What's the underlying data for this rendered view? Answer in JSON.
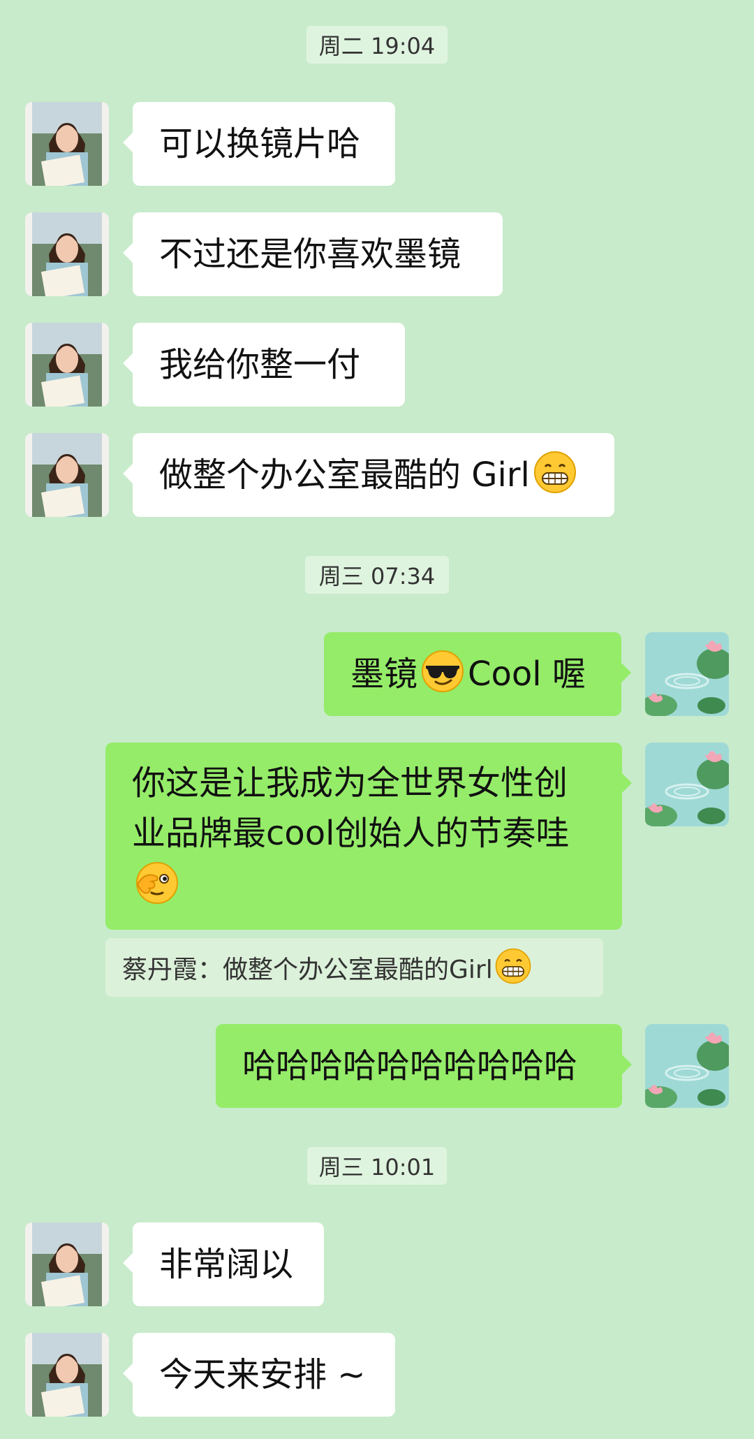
{
  "timestamps": [
    "周二 19:04",
    "周三 07:34",
    "周三 10:01"
  ],
  "messages": [
    {
      "text": "可以换镜片哈"
    },
    {
      "text": "不过还是你喜欢墨镜"
    },
    {
      "text": "我给你整一付"
    },
    {
      "text": "做整个办公室最酷的 Girl",
      "emoji": "grinning-emoji"
    },
    {
      "text_a": "墨镜",
      "emoji": "sunglasses-emoji",
      "text_b": " Cool 喔"
    },
    {
      "text": "你这是让我成为全世界女性创业品牌最cool创始人的节奏哇",
      "emoji": "wink-hand-emoji"
    },
    {
      "text": "哈哈哈哈哈哈哈哈哈哈"
    },
    {
      "text": "非常阔以"
    },
    {
      "text": "今天来安排 ~"
    }
  ],
  "quote": {
    "text": "蔡丹霞：做整个办公室最酷的Girl",
    "emoji": "grinning-emoji"
  },
  "colors": {
    "background": "#c8ebcb",
    "sent_bubble": "#95ec69",
    "received_bubble": "#ffffff"
  }
}
